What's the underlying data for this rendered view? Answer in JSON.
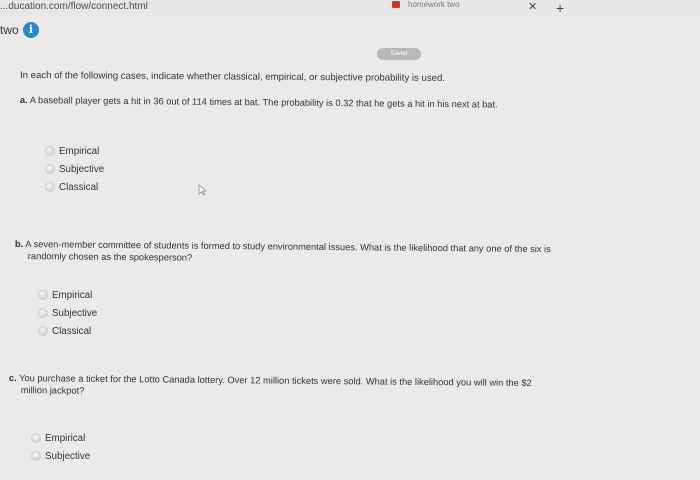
{
  "browser": {
    "url": "...ducation.com/flow/connect.html",
    "tab_title": "homework two"
  },
  "assignment": {
    "name": "two",
    "save_status": "Saved"
  },
  "instructions": "In each of the following cases, indicate whether classical, empirical, or subjective probability is used.",
  "questions": [
    {
      "letter": "a.",
      "lines": [
        "A baseball player gets a hit in 36 out of 114 times at bat. The probability is 0.32 that he gets a hit in his next at bat."
      ],
      "options": [
        "Empirical",
        "Subjective",
        "Classical"
      ]
    },
    {
      "letter": "b.",
      "lines": [
        "A seven-member committee of students is formed to study environmental issues. What is the likelihood that any one of the six is",
        "randomly chosen as the spokesperson?"
      ],
      "options": [
        "Empirical",
        "Subjective",
        "Classical"
      ]
    },
    {
      "letter": "c.",
      "lines": [
        "You purchase a ticket for the Lotto Canada lottery. Over 12 million tickets were sold. What is the likelihood you will win the $2",
        "million jackpot?"
      ],
      "options": [
        "Empirical",
        "Subjective"
      ]
    }
  ],
  "colors": {
    "background": "#eceae8",
    "info_icon": "#2a87c8",
    "brand_favicon": "#d9342b",
    "saved_badge": "#b9b8b6"
  }
}
